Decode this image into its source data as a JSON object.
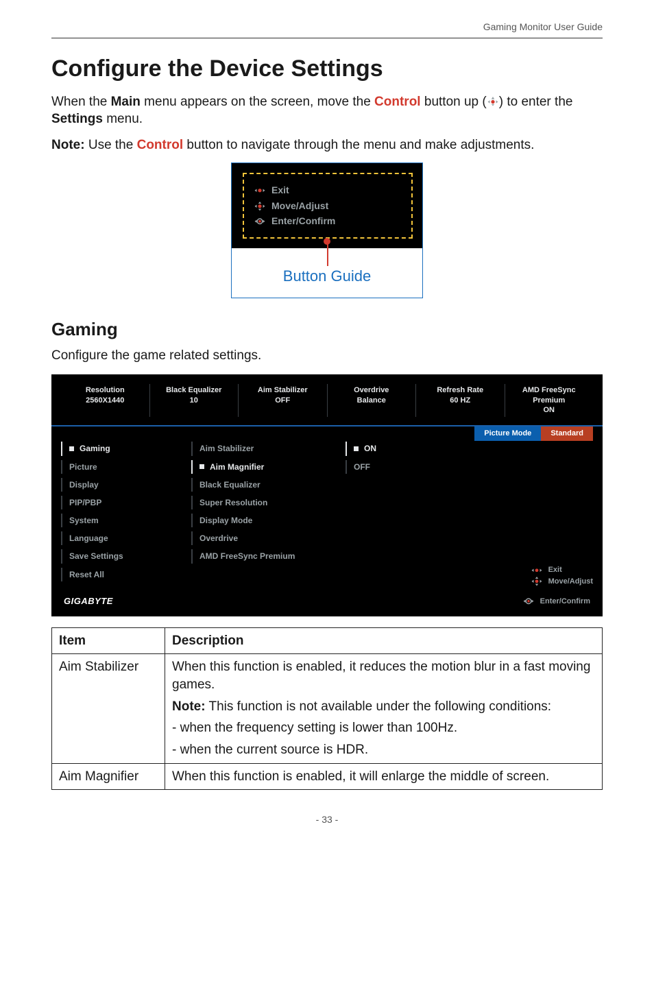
{
  "header": {
    "runningHead": "Gaming Monitor User Guide"
  },
  "title": "Configure the Device Settings",
  "intro": {
    "before_main": "When the ",
    "main_word": "Main",
    "mid1": " menu appears on the screen, move the ",
    "control_word": "Control",
    "mid2": " button up (",
    "after_icon": ") to enter the ",
    "settings_word": "Settings",
    "end": " menu."
  },
  "note": {
    "label": "Note:",
    "before_control": " Use the ",
    "control_word": "Control",
    "after_control": " button to navigate through the menu and make adjustments."
  },
  "button_guide": {
    "exit": "Exit",
    "move_adjust": "Move/Adjust",
    "enter_confirm": "Enter/Confirm",
    "caption": "Button Guide"
  },
  "gaming_section": {
    "heading": "Gaming",
    "intro": "Configure the game related settings."
  },
  "osd": {
    "top": [
      {
        "t1": "Resolution",
        "t2": "2560X1440"
      },
      {
        "t1": "Black Equalizer",
        "t2": "10"
      },
      {
        "t1": "Aim Stabilizer",
        "t2": "OFF"
      },
      {
        "t1": "Overdrive",
        "t2": "Balance"
      },
      {
        "t1": "Refresh Rate",
        "t2": "60 HZ"
      },
      {
        "t1": "AMD FreeSync Premium",
        "t2": "ON"
      }
    ],
    "badges": {
      "picture_mode": "Picture Mode",
      "standard": "Standard"
    },
    "menu": {
      "col1": [
        {
          "label": "Gaming",
          "active": true
        },
        {
          "label": "Picture"
        },
        {
          "label": "Display"
        },
        {
          "label": "PIP/PBP"
        },
        {
          "label": "System"
        },
        {
          "label": "Language"
        },
        {
          "label": "Save Settings"
        },
        {
          "label": "Reset All"
        }
      ],
      "col2": [
        {
          "label": "Aim Stabilizer"
        },
        {
          "label": "Aim Magnifier",
          "active": true
        },
        {
          "label": "Black Equalizer"
        },
        {
          "label": "Super Resolution"
        },
        {
          "label": "Display Mode"
        },
        {
          "label": "Overdrive"
        },
        {
          "label": "AMD FreeSync Premium"
        }
      ],
      "col3": [
        {
          "label": "ON",
          "active": true
        },
        {
          "label": "OFF"
        }
      ]
    },
    "hints": {
      "exit": "Exit",
      "move_adjust": "Move/Adjust",
      "enter_confirm": "Enter/Confirm"
    },
    "logo": "GIGABYTE"
  },
  "table": {
    "headers": {
      "item": "Item",
      "description": "Description"
    },
    "rows": [
      {
        "item": "Aim Stabilizer",
        "desc_p1": "When this function is enabled, it reduces the motion blur in a fast moving games.",
        "desc_note_label": "Note:",
        "desc_note_text": " This function is not available under the following conditions:",
        "desc_b1": "- when the frequency setting is lower than 100Hz.",
        "desc_b2": "- when the current source is HDR."
      },
      {
        "item": "Aim Magnifier",
        "desc_p1": "When this function is enabled, it will enlarge the middle of screen."
      }
    ]
  },
  "page_number": "- 33 -",
  "icons": {
    "joy_left": "◀●▶",
    "joy_all": "◀●▶",
    "joy_right": "●▶"
  }
}
